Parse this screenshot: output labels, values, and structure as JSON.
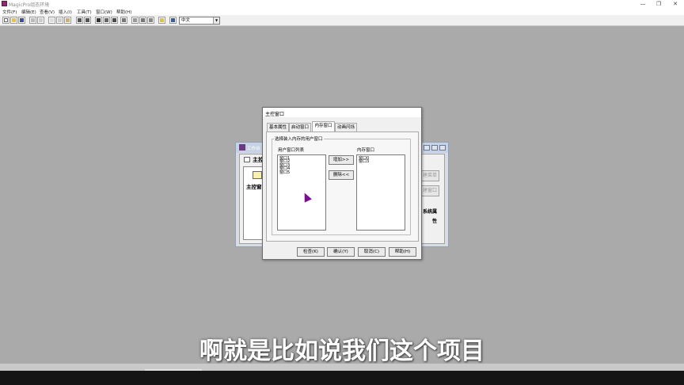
{
  "app": {
    "title": "MagicPro组态环境",
    "window_controls": [
      "—",
      "❐",
      "✕"
    ]
  },
  "menu": [
    "文件(F)",
    "编辑(E)",
    "查看(V)",
    "插入(I)",
    "工具(T)",
    "窗口(W)",
    "帮助(H)"
  ],
  "toolbar": {
    "language": "中文",
    "icons": [
      "new-icon",
      "open-icon",
      "save-icon",
      "print-icon",
      "preview-icon",
      "cut-icon",
      "copy-icon",
      "paste-icon",
      "undo-icon",
      "redo-icon",
      "select-icon",
      "align-icon",
      "grid-icon",
      "table-icon",
      "form-icon",
      "check-icon",
      "list-icon",
      "help-icon",
      "settings-icon"
    ]
  },
  "background_window": {
    "title": "工作台",
    "heading": "主控窗口",
    "control_label": "主控窗",
    "right_buttons": [
      "建菜单",
      "建窗口",
      "系统属性"
    ]
  },
  "dialog": {
    "title": "主控窗口",
    "tabs": [
      "基本属性",
      "启动窗口",
      "内存窗口",
      "动画闪烁"
    ],
    "active_tab": "内存窗口",
    "group_label": "选择装入内存的用户窗口",
    "user_list_label": "用户窗口列表",
    "user_list": [
      "窗口1",
      "窗口2",
      "窗口3",
      "窗口4",
      "窗口5"
    ],
    "memory_list_label": "内存窗口",
    "memory_list": [
      "窗口0",
      "窗口3"
    ],
    "add_button": "增加>>",
    "delete_button": "删除<<",
    "bottom_buttons": {
      "check": "检查(K)",
      "ok": "确认(Y)",
      "cancel": "取消(C)",
      "help": "帮助(H)"
    }
  },
  "subtitle": "啊就是比如说我们这个项目",
  "colors": {
    "desktop": "#aaaaaa",
    "dialog_bg": "#f0f0f0",
    "cursor": "#7a0e8f",
    "taskbar": "#151515"
  }
}
